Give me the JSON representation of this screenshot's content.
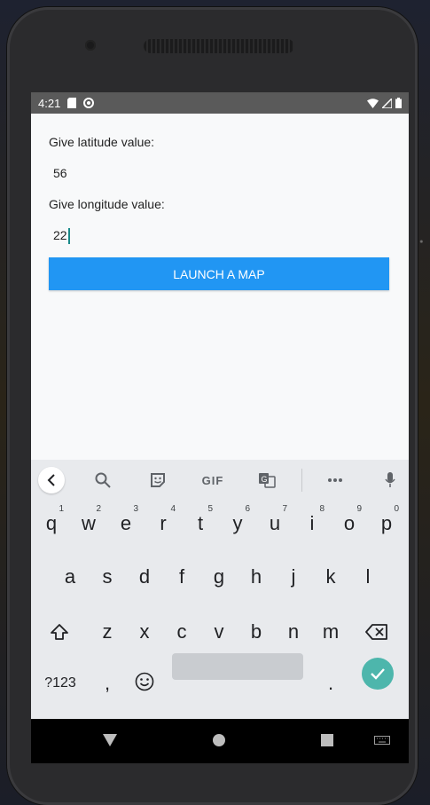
{
  "status_bar": {
    "time": "4:21"
  },
  "form": {
    "latitude_label": "Give latitude value:",
    "latitude_value": "56",
    "longitude_label": "Give longitude value:",
    "longitude_value": "22",
    "launch_button_label": "LAUNCH A MAP"
  },
  "keyboard": {
    "toolbar": {
      "gif_label": "GIF",
      "icons": [
        "back-icon",
        "search-icon",
        "sticker-icon",
        "gif-icon",
        "translate-icon",
        "more-icon",
        "mic-icon"
      ]
    },
    "row1": [
      {
        "key": "q",
        "hint": "1"
      },
      {
        "key": "w",
        "hint": "2"
      },
      {
        "key": "e",
        "hint": "3"
      },
      {
        "key": "r",
        "hint": "4"
      },
      {
        "key": "t",
        "hint": "5"
      },
      {
        "key": "y",
        "hint": "6"
      },
      {
        "key": "u",
        "hint": "7"
      },
      {
        "key": "i",
        "hint": "8"
      },
      {
        "key": "o",
        "hint": "9"
      },
      {
        "key": "p",
        "hint": "0"
      }
    ],
    "row2": [
      "a",
      "s",
      "d",
      "f",
      "g",
      "h",
      "j",
      "k",
      "l"
    ],
    "row3": [
      "z",
      "x",
      "c",
      "v",
      "b",
      "n",
      "m"
    ],
    "bottom": {
      "symbols_label": "?123",
      "comma": ",",
      "period": "."
    }
  },
  "colors": {
    "accent": "#2196f3",
    "enter_key": "#4db6ac",
    "status_bar": "#5a5a5a"
  }
}
